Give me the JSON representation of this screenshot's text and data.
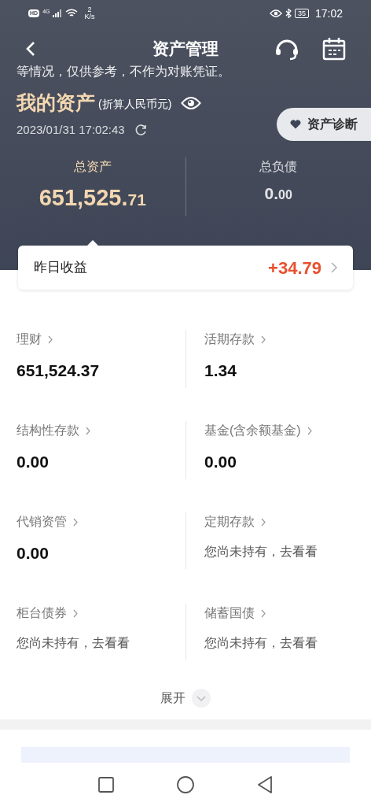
{
  "status_bar": {
    "hd_label": "HD",
    "network": "4G",
    "speed_value": "2",
    "speed_unit": "K/s",
    "battery": "35",
    "time": "17:02"
  },
  "nav": {
    "title": "资产管理"
  },
  "notice": "等情况，仅供参考，不作为对账凭证。",
  "summary": {
    "title": "我的资产",
    "currency_note": "(折算人民币元)",
    "timestamp": "2023/01/31 17:02:43",
    "diagnose_button": "资产诊断"
  },
  "totals": [
    {
      "label": "总资产",
      "integer": "651,525.",
      "decimal": "71",
      "highlight": true
    },
    {
      "label": "总负债",
      "integer": "0.",
      "decimal": "00",
      "highlight": false
    }
  ],
  "yesterday": {
    "label": "昨日收益",
    "value": "+34.79"
  },
  "categories": [
    {
      "label": "理财",
      "kind": "amount",
      "value": "651,524.37"
    },
    {
      "label": "活期存款",
      "kind": "amount",
      "value": "1.34"
    },
    {
      "label": "结构性存款",
      "kind": "amount",
      "value": "0.00"
    },
    {
      "label": "基金(含余额基金)",
      "kind": "amount",
      "value": "0.00"
    },
    {
      "label": "代销资管",
      "kind": "amount",
      "value": "0.00"
    },
    {
      "label": "定期存款",
      "kind": "empty",
      "value": "您尚未持有，去看看"
    },
    {
      "label": "柜台债券",
      "kind": "empty",
      "value": "您尚未持有，去看看"
    },
    {
      "label": "储蓄国债",
      "kind": "empty",
      "value": "您尚未持有，去看看"
    }
  ],
  "expand_button": "展开"
}
